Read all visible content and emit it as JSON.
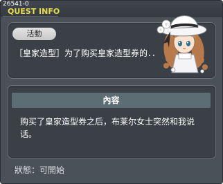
{
  "quest_id": "26541-0",
  "window_title": "QUEST INFO",
  "quest": {
    "category_badge": "活動",
    "summary": "［皇家造型］为了购买皇家造型券的．．"
  },
  "details": {
    "header": "內容",
    "description": "购买了皇家造型券之后，布莱尔女士突然和我说话。"
  },
  "status": {
    "label": "狀態：",
    "value": "可開始"
  },
  "colors": {
    "title_yellow": "#e9dd4e",
    "window_bg": "#4a5157",
    "panel_bg": "#3a4045",
    "header_bar": "#5c6d74"
  },
  "icons": {
    "npc": "npc-portrait-lady-white-hat"
  }
}
